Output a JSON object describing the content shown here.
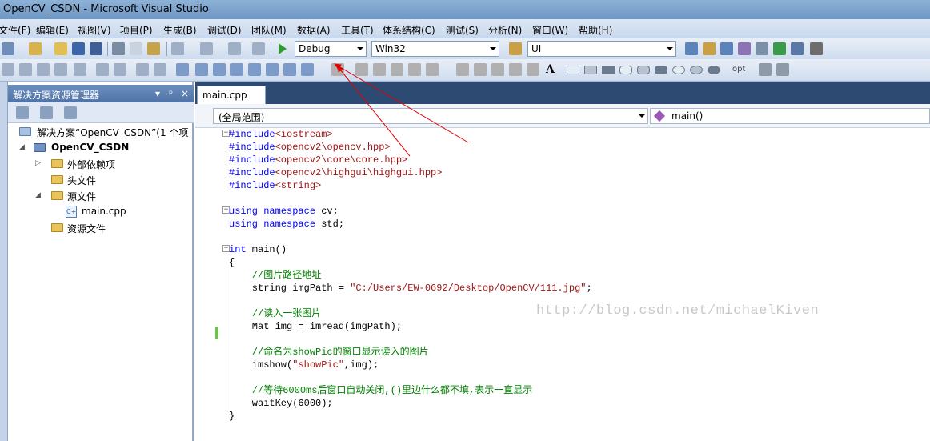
{
  "window": {
    "title": "OpenCV_CSDN - Microsoft Visual Studio"
  },
  "menu": [
    "文件(F)",
    "编辑(E)",
    "视图(V)",
    "项目(P)",
    "生成(B)",
    "调试(D)",
    "团队(M)",
    "数据(A)",
    "工具(T)",
    "体系结构(C)",
    "测试(S)",
    "分析(N)",
    "窗口(W)",
    "帮助(H)"
  ],
  "toolbar": {
    "config": "Debug",
    "platform": "Win32",
    "find": "UI",
    "opt_label": "opt"
  },
  "solution_explorer": {
    "title": "解决方案资源管理器",
    "pin": "ᵖ",
    "close": "×",
    "items": [
      {
        "label": "解决方案“OpenCV_CSDN”(1 个项"
      },
      {
        "label": "OpenCV_CSDN"
      },
      {
        "label": "外部依赖项"
      },
      {
        "label": "头文件"
      },
      {
        "label": "源文件"
      },
      {
        "label": "main.cpp"
      },
      {
        "label": "资源文件"
      }
    ]
  },
  "editor": {
    "tab": "main.cpp",
    "scope": "(全局范围)",
    "member": "main()"
  },
  "code": [
    {
      "parts": [
        [
          "kw",
          "#include"
        ],
        [
          "str",
          "<iostream>"
        ]
      ]
    },
    {
      "parts": [
        [
          "kw",
          "#include"
        ],
        [
          "str",
          "<opencv2\\opencv.hpp>"
        ]
      ]
    },
    {
      "parts": [
        [
          "kw",
          "#include"
        ],
        [
          "str",
          "<opencv2\\core\\core.hpp>"
        ]
      ]
    },
    {
      "parts": [
        [
          "kw",
          "#include"
        ],
        [
          "str",
          "<opencv2\\highgui\\highgui.hpp>"
        ]
      ]
    },
    {
      "parts": [
        [
          "kw",
          "#include"
        ],
        [
          "str",
          "<string>"
        ]
      ]
    },
    {
      "parts": []
    },
    {
      "parts": [
        [
          "kw",
          "using"
        ],
        [
          "",
          " "
        ],
        [
          "kw",
          "namespace"
        ],
        [
          "",
          " cv;"
        ]
      ]
    },
    {
      "parts": [
        [
          "kw",
          "using"
        ],
        [
          "",
          " "
        ],
        [
          "kw",
          "namespace"
        ],
        [
          "",
          " std;"
        ]
      ]
    },
    {
      "parts": []
    },
    {
      "parts": [
        [
          "kw",
          "int"
        ],
        [
          "",
          " main()"
        ]
      ]
    },
    {
      "parts": [
        [
          "",
          "{"
        ]
      ]
    },
    {
      "parts": [
        [
          "",
          "    "
        ],
        [
          "cm",
          "//图片路径地址"
        ]
      ]
    },
    {
      "parts": [
        [
          "",
          "    string imgPath = "
        ],
        [
          "str",
          "\"C:/Users/EW-0692/Desktop/OpenCV/111.jpg\""
        ],
        [
          "",
          ";"
        ]
      ]
    },
    {
      "parts": []
    },
    {
      "parts": [
        [
          "",
          "    "
        ],
        [
          "cm",
          "//读入一张图片"
        ]
      ]
    },
    {
      "parts": [
        [
          "",
          "    Mat img = imread(imgPath);"
        ]
      ]
    },
    {
      "parts": []
    },
    {
      "parts": [
        [
          "",
          "    "
        ],
        [
          "cm",
          "//命名为showPic的窗口显示读入的图片"
        ]
      ]
    },
    {
      "parts": [
        [
          "",
          "    imshow("
        ],
        [
          "str",
          "\"showPic\""
        ],
        [
          "",
          ",img);"
        ]
      ]
    },
    {
      "parts": []
    },
    {
      "parts": [
        [
          "",
          "    "
        ],
        [
          "cm",
          "//等待6000ms后窗口自动关闭,()里边什么都不填,表示一直显示"
        ]
      ]
    },
    {
      "parts": [
        [
          "",
          "    waitKey(6000);"
        ]
      ]
    },
    {
      "parts": [
        [
          "",
          "}"
        ]
      ]
    }
  ],
  "watermark": "http://blog.csdn.net/michaelKiven",
  "colors": {
    "keyword": "#0000ff",
    "string": "#a31515",
    "comment": "#008000",
    "annotation": "#e00000"
  }
}
